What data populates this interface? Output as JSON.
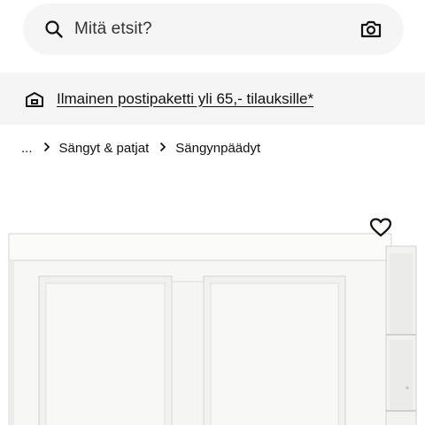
{
  "search": {
    "placeholder": "Mitä etsit?",
    "icon": "search-icon",
    "camera_icon": "camera-icon"
  },
  "promo": {
    "icon": "truck-icon",
    "text": "Ilmainen postipaketti yli 65,- tilauksille*"
  },
  "breadcrumb": {
    "items": [
      {
        "label": "..."
      },
      {
        "label": "Sängyt & patjat"
      },
      {
        "label": "Sängynpäädyt"
      }
    ],
    "separator_icon": "chevron-right-icon"
  },
  "product": {
    "image_icon": "white-headboard-image",
    "favorite_icon": "heart-icon"
  }
}
